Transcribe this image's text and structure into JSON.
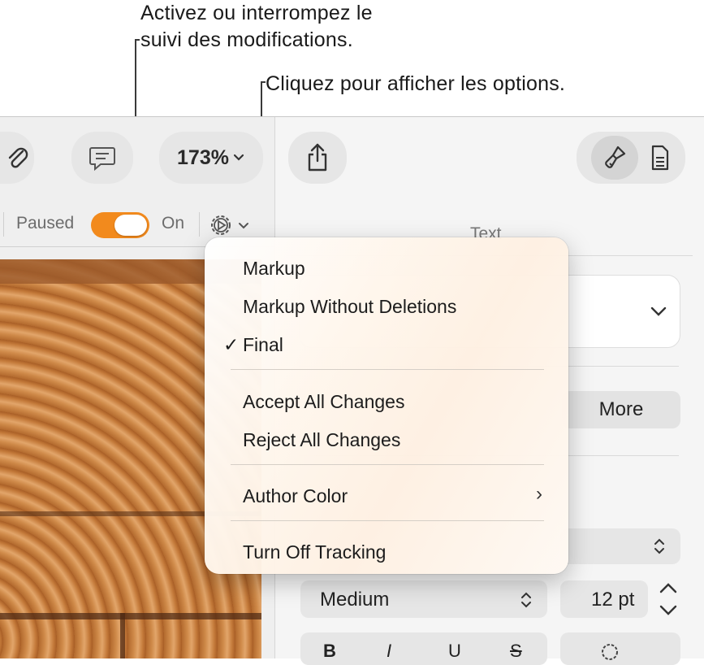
{
  "callouts": {
    "tracking_line1": "Activez ou interrompez le",
    "tracking_line2": "suivi des modifications.",
    "options": "Cliquez pour afficher les options."
  },
  "toolbar": {
    "zoom_label": "173%",
    "icons": [
      "paperclip-icon",
      "comment-icon",
      "share-icon",
      "format-brush-icon",
      "document-icon"
    ]
  },
  "tracking": {
    "paused_label": "Paused",
    "on_label": "On",
    "toggle_state": "on",
    "toggle_color": "#F28A1D"
  },
  "right_panel": {
    "tab_label": "Text",
    "more_label": "More",
    "font_weight": "Medium",
    "font_size": "12 pt",
    "format_buttons": [
      "B",
      "I",
      "U",
      "S"
    ]
  },
  "menu": {
    "items": [
      {
        "label": "Markup",
        "checked": false
      },
      {
        "label": "Markup Without Deletions",
        "checked": false
      },
      {
        "label": "Final",
        "checked": true
      },
      {
        "label": "Accept All Changes",
        "checked": false
      },
      {
        "label": "Reject All Changes",
        "checked": false
      },
      {
        "label": "Author Color",
        "checked": false,
        "submenu": true
      },
      {
        "label": "Turn Off Tracking",
        "checked": false
      }
    ],
    "check_glyph": "✓",
    "submenu_glyph": "›"
  }
}
